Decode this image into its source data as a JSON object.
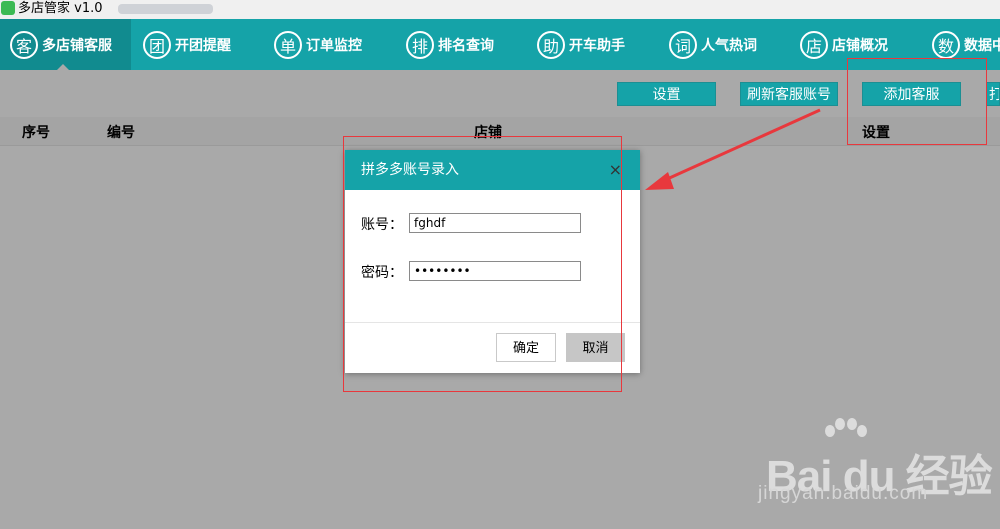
{
  "window": {
    "title": "多店管家 v1.0"
  },
  "nav": {
    "items": [
      {
        "icon_char": "客",
        "label": "多店铺客服",
        "icon": "customer-service-icon"
      },
      {
        "icon_char": "团",
        "label": "开团提醒",
        "icon": "group-icon"
      },
      {
        "icon_char": "单",
        "label": "订单监控",
        "icon": "order-icon"
      },
      {
        "icon_char": "排",
        "label": "排名查询",
        "icon": "ranking-icon"
      },
      {
        "icon_char": "助",
        "label": "开车助手",
        "icon": "assistant-icon"
      },
      {
        "icon_char": "词",
        "label": "人气热词",
        "icon": "keyword-icon"
      },
      {
        "icon_char": "店",
        "label": "店铺概况",
        "icon": "shop-icon"
      },
      {
        "icon_char": "数",
        "label": "数据中",
        "icon": "data-icon"
      }
    ]
  },
  "toolbar": {
    "settings_label": "设置",
    "refresh_label": "刷新客服账号",
    "add_label": "添加客服",
    "more_label": "打"
  },
  "table": {
    "headers": {
      "index": "序号",
      "code": "编号",
      "shop": "店铺",
      "settings": "设置"
    }
  },
  "dialog": {
    "title": "拼多多账号录入",
    "close_symbol": "×",
    "account_label": "账号：",
    "account_value": "fghdf",
    "password_label": "密码：",
    "password_value": "••••••••",
    "ok_label": "确定",
    "cancel_label": "取消"
  },
  "watermark": {
    "brand": "Bai du 经验",
    "url": "jingyan.baidu.com"
  },
  "colors": {
    "accent": "#15a3a8",
    "annotation": "#e8383d",
    "backdrop": "#a9a9a9"
  }
}
